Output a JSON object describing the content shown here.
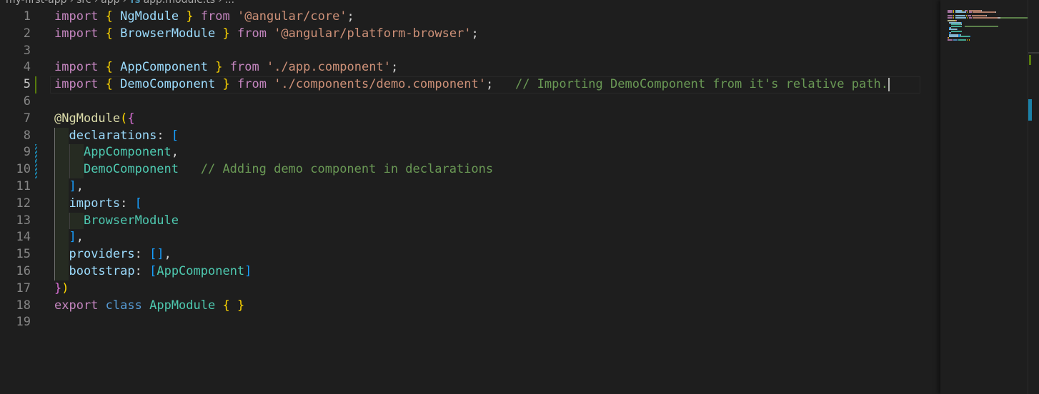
{
  "breadcrumb": {
    "items": [
      "my-first-app",
      "src",
      "app"
    ],
    "file_icon": "TS",
    "file_name": "app.module.ts",
    "tail": "..."
  },
  "editor": {
    "active_line": 5,
    "lines": [
      {
        "n": "1",
        "tokens": [
          [
            "k-ctrl",
            "import"
          ],
          [
            "punc",
            " "
          ],
          [
            "b1",
            "{"
          ],
          [
            "punc",
            " "
          ],
          [
            "var",
            "NgModule"
          ],
          [
            "punc",
            " "
          ],
          [
            "b1",
            "}"
          ],
          [
            "punc",
            " "
          ],
          [
            "k-ctrl",
            "from"
          ],
          [
            "punc",
            " "
          ],
          [
            "str",
            "'@angular/core'"
          ],
          [
            "punc",
            ";"
          ]
        ]
      },
      {
        "n": "2",
        "tokens": [
          [
            "k-ctrl",
            "import"
          ],
          [
            "punc",
            " "
          ],
          [
            "b1",
            "{"
          ],
          [
            "punc",
            " "
          ],
          [
            "var",
            "BrowserModule"
          ],
          [
            "punc",
            " "
          ],
          [
            "b1",
            "}"
          ],
          [
            "punc",
            " "
          ],
          [
            "k-ctrl",
            "from"
          ],
          [
            "punc",
            " "
          ],
          [
            "str",
            "'@angular/platform-browser'"
          ],
          [
            "punc",
            ";"
          ]
        ]
      },
      {
        "n": "3",
        "tokens": []
      },
      {
        "n": "4",
        "tokens": [
          [
            "k-ctrl",
            "import"
          ],
          [
            "punc",
            " "
          ],
          [
            "b1",
            "{"
          ],
          [
            "punc",
            " "
          ],
          [
            "var",
            "AppComponent"
          ],
          [
            "punc",
            " "
          ],
          [
            "b1",
            "}"
          ],
          [
            "punc",
            " "
          ],
          [
            "k-ctrl",
            "from"
          ],
          [
            "punc",
            " "
          ],
          [
            "str",
            "'./app.component'"
          ],
          [
            "punc",
            ";"
          ]
        ]
      },
      {
        "n": "5",
        "tokens": [
          [
            "k-ctrl",
            "import"
          ],
          [
            "punc",
            " "
          ],
          [
            "b1",
            "{"
          ],
          [
            "punc",
            " "
          ],
          [
            "var",
            "DemoComponent"
          ],
          [
            "punc",
            " "
          ],
          [
            "b1",
            "}"
          ],
          [
            "punc",
            " "
          ],
          [
            "k-ctrl",
            "from"
          ],
          [
            "punc",
            " "
          ],
          [
            "str",
            "'./components/demo.component'"
          ],
          [
            "punc",
            ";   "
          ],
          [
            "com",
            "// Importing DemoComponent from it's relative path."
          ]
        ]
      },
      {
        "n": "6",
        "tokens": []
      },
      {
        "n": "7",
        "tokens": [
          [
            "fn",
            "@"
          ],
          [
            "fn",
            "NgModule"
          ],
          [
            "b1",
            "("
          ],
          [
            "b2",
            "{"
          ]
        ]
      },
      {
        "n": "8",
        "tokens": [
          [
            "punc",
            "  "
          ],
          [
            "var",
            "declarations"
          ],
          [
            "punc",
            ": "
          ],
          [
            "b3",
            "["
          ]
        ]
      },
      {
        "n": "9",
        "tokens": [
          [
            "punc",
            "    "
          ],
          [
            "type",
            "AppComponent"
          ],
          [
            "punc",
            ","
          ]
        ]
      },
      {
        "n": "10",
        "tokens": [
          [
            "punc",
            "    "
          ],
          [
            "type",
            "DemoComponent"
          ],
          [
            "punc",
            "   "
          ],
          [
            "com",
            "// Adding demo component in declarations"
          ]
        ]
      },
      {
        "n": "11",
        "tokens": [
          [
            "punc",
            "  "
          ],
          [
            "b3",
            "]"
          ],
          [
            "punc",
            ","
          ]
        ]
      },
      {
        "n": "12",
        "tokens": [
          [
            "punc",
            "  "
          ],
          [
            "var",
            "imports"
          ],
          [
            "punc",
            ": "
          ],
          [
            "b3",
            "["
          ]
        ]
      },
      {
        "n": "13",
        "tokens": [
          [
            "punc",
            "    "
          ],
          [
            "type",
            "BrowserModule"
          ]
        ]
      },
      {
        "n": "14",
        "tokens": [
          [
            "punc",
            "  "
          ],
          [
            "b3",
            "]"
          ],
          [
            "punc",
            ","
          ]
        ]
      },
      {
        "n": "15",
        "tokens": [
          [
            "punc",
            "  "
          ],
          [
            "var",
            "providers"
          ],
          [
            "punc",
            ": "
          ],
          [
            "b3",
            "[]"
          ],
          [
            "punc",
            ","
          ]
        ]
      },
      {
        "n": "16",
        "tokens": [
          [
            "punc",
            "  "
          ],
          [
            "var",
            "bootstrap"
          ],
          [
            "punc",
            ": "
          ],
          [
            "b3",
            "["
          ],
          [
            "type",
            "AppComponent"
          ],
          [
            "b3",
            "]"
          ]
        ]
      },
      {
        "n": "17",
        "tokens": [
          [
            "b2",
            "}"
          ],
          [
            "b1",
            ")"
          ]
        ]
      },
      {
        "n": "18",
        "tokens": [
          [
            "k-ctrl",
            "export"
          ],
          [
            "punc",
            " "
          ],
          [
            "k-decl",
            "class"
          ],
          [
            "punc",
            " "
          ],
          [
            "type",
            "AppModule"
          ],
          [
            "punc",
            " "
          ],
          [
            "b1",
            "{"
          ],
          [
            "punc",
            " "
          ],
          [
            "b1",
            "}"
          ]
        ]
      },
      {
        "n": "19",
        "tokens": []
      }
    ]
  },
  "colors": {
    "background": "#1e1e1e",
    "keyword": "#c586c0",
    "variable": "#9cdcfe",
    "type": "#4ec9b0",
    "string": "#ce9178",
    "comment": "#6a9955",
    "git_added": "#587c0c",
    "git_modified": "#1b81a8"
  }
}
